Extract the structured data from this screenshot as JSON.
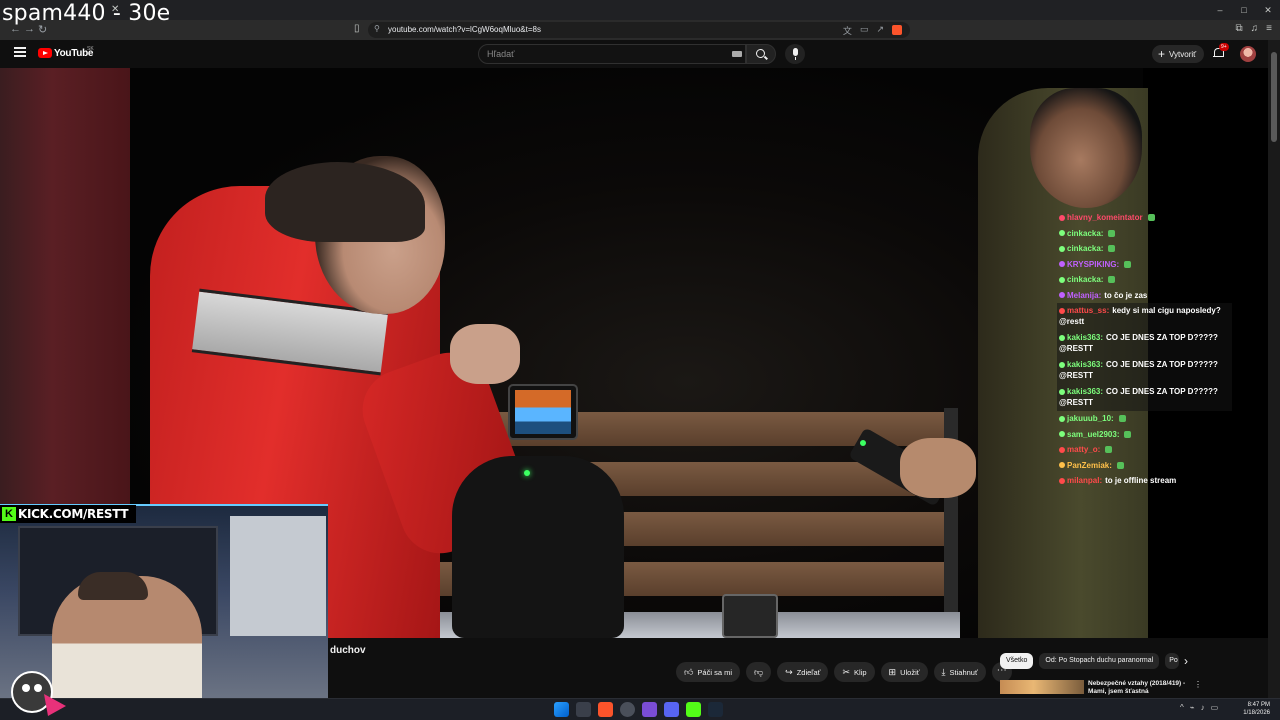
{
  "overlay": {
    "caption": "spam440 - 30e"
  },
  "browser": {
    "url": "youtube.com/watch?v=lCgW6oqMluo&t=8s",
    "window_controls": [
      "–",
      "□",
      "✕"
    ]
  },
  "youtube": {
    "logo_text": "YouTube",
    "country_code": "SK",
    "search_placeholder": "Hľadať",
    "create_label": "Vytvoriť",
    "notification_count": "9+"
  },
  "stream": {
    "kick_banner": "KICK.COM/RESTT",
    "chat": [
      {
        "user": "hlavny_komeintator",
        "color": "#ff4a6b",
        "text": ""
      },
      {
        "user": "cinkacka:",
        "color": "#7dff7d",
        "text": ""
      },
      {
        "user": "cinkacka:",
        "color": "#7dff7d",
        "text": ""
      },
      {
        "user": "KRYSPIKING:",
        "color": "#c060ff",
        "text": ""
      },
      {
        "user": "cinkacka:",
        "color": "#7dff7d",
        "text": ""
      },
      {
        "user": "Melanija:",
        "color": "#c060ff",
        "text": "to čo je zas"
      },
      {
        "user": "mattus_ss:",
        "color": "#ff4a4a",
        "text": "kedy si mal cigu naposledy? @restt"
      },
      {
        "user": "kakis363:",
        "color": "#7dff7d",
        "text": "CO JE DNES ZA TOP D????? @RESTT"
      },
      {
        "user": "kakis363:",
        "color": "#7dff7d",
        "text": "CO JE DNES ZA TOP D????? @RESTT"
      },
      {
        "user": "kakis363:",
        "color": "#7dff7d",
        "text": "CO JE DNES ZA TOP D????? @RESTT"
      },
      {
        "user": "jakuuub_10:",
        "color": "#7dff7d",
        "text": ""
      },
      {
        "user": "sam_uel2903:",
        "color": "#7dff7d",
        "text": ""
      },
      {
        "user": "matty_o:",
        "color": "#ff4a4a",
        "text": ""
      },
      {
        "user": "PanZemiak:",
        "color": "#ffc04a",
        "text": ""
      },
      {
        "user": "milanpal:",
        "color": "#ff4a4a",
        "text": "to je offline stream"
      }
    ]
  },
  "video": {
    "title_fragment": "duchov"
  },
  "actions": {
    "like": "Páči sa mi",
    "share": "Zdieľať",
    "clip": "Klip",
    "save": "Uložiť",
    "download": "Stiahnuť"
  },
  "chips": {
    "all": "Všetko",
    "from": "Od: Po Stopach duchu paranormal",
    "partial": "Po"
  },
  "recommendation": {
    "title": "Nebezpečné vztahy (2018/419) - Mami, jsem šťastná"
  },
  "clock": {
    "time": "8:47 PM",
    "date": "1/18/2026"
  }
}
